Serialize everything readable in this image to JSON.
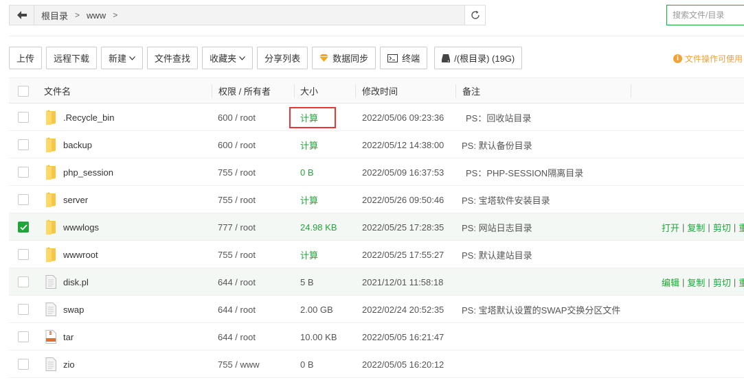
{
  "path": {
    "crumbs": [
      "根目录",
      "www"
    ],
    "search_placeholder": "搜索文件/目录"
  },
  "toolbar": {
    "upload": "上传",
    "remote_download": "远程下载",
    "new": "新建",
    "file_search": "文件查找",
    "favorites": "收藏夹",
    "share_list": "分享列表",
    "data_sync": "数据同步",
    "terminal": "终端",
    "disk": "/(根目录) (19G)",
    "notice": "文件操作可使用"
  },
  "table": {
    "headers": {
      "name": "文件名",
      "perm": "权限 / 所有者",
      "size": "大小",
      "mtime": "修改时间",
      "note": "备注"
    },
    "rows": [
      {
        "name": ".Recycle_bin",
        "type": "folder",
        "perm": "600 / root",
        "size": "计算",
        "mtime": "2022/05/06 09:23:36",
        "note": "PS：回收站目录",
        "checked": false,
        "ops": []
      },
      {
        "name": "backup",
        "type": "folder",
        "perm": "600 / root",
        "size": "计算",
        "mtime": "2022/05/12 14:38:00",
        "note": "PS: 默认备份目录",
        "checked": false,
        "ops": []
      },
      {
        "name": "php_session",
        "type": "folder",
        "perm": "755 / root",
        "size": "0 B",
        "mtime": "2022/05/09 16:37:53",
        "note": "PS：PHP-SESSION隔离目录",
        "checked": false,
        "ops": []
      },
      {
        "name": "server",
        "type": "folder",
        "perm": "755 / root",
        "size": "计算",
        "mtime": "2022/05/26 09:50:46",
        "note": "PS: 宝塔软件安装目录",
        "checked": false,
        "ops": []
      },
      {
        "name": "wwwlogs",
        "type": "folder",
        "perm": "777 / root",
        "size": "24.98 KB",
        "mtime": "2022/05/25 17:28:35",
        "note": "PS: 网站日志目录",
        "checked": true,
        "ops": [
          "打开",
          "复制",
          "剪切",
          "重命名"
        ]
      },
      {
        "name": "wwwroot",
        "type": "folder",
        "perm": "755 / root",
        "size": "计算",
        "mtime": "2022/05/25 17:55:27",
        "note": "PS: 默认建站目录",
        "checked": false,
        "ops": []
      },
      {
        "name": "disk.pl",
        "type": "file",
        "perm": "644 / root",
        "size": "5 B",
        "mtime": "2021/12/01 11:58:18",
        "note": "",
        "checked": false,
        "ops": [
          "编辑",
          "复制",
          "剪切",
          "重命名"
        ]
      },
      {
        "name": "swap",
        "type": "file",
        "perm": "644 / root",
        "size": "2.00 GB",
        "mtime": "2022/02/24 20:52:35",
        "note": "PS: 宝塔默认设置的SWAP交换分区文件",
        "checked": false,
        "ops": []
      },
      {
        "name": "tar",
        "type": "archive",
        "perm": "644 / root",
        "size": "10.00 KB",
        "mtime": "2022/05/05 16:21:47",
        "note": "",
        "checked": false,
        "ops": []
      },
      {
        "name": "zio",
        "type": "file",
        "perm": "755 / www",
        "size": "0 B",
        "mtime": "2022/05/05 16:20:12",
        "note": "",
        "checked": false,
        "ops": []
      }
    ]
  },
  "colors": {
    "accent": "#20a53a",
    "warn": "#f0a33a",
    "highlight": "#ee3333"
  }
}
